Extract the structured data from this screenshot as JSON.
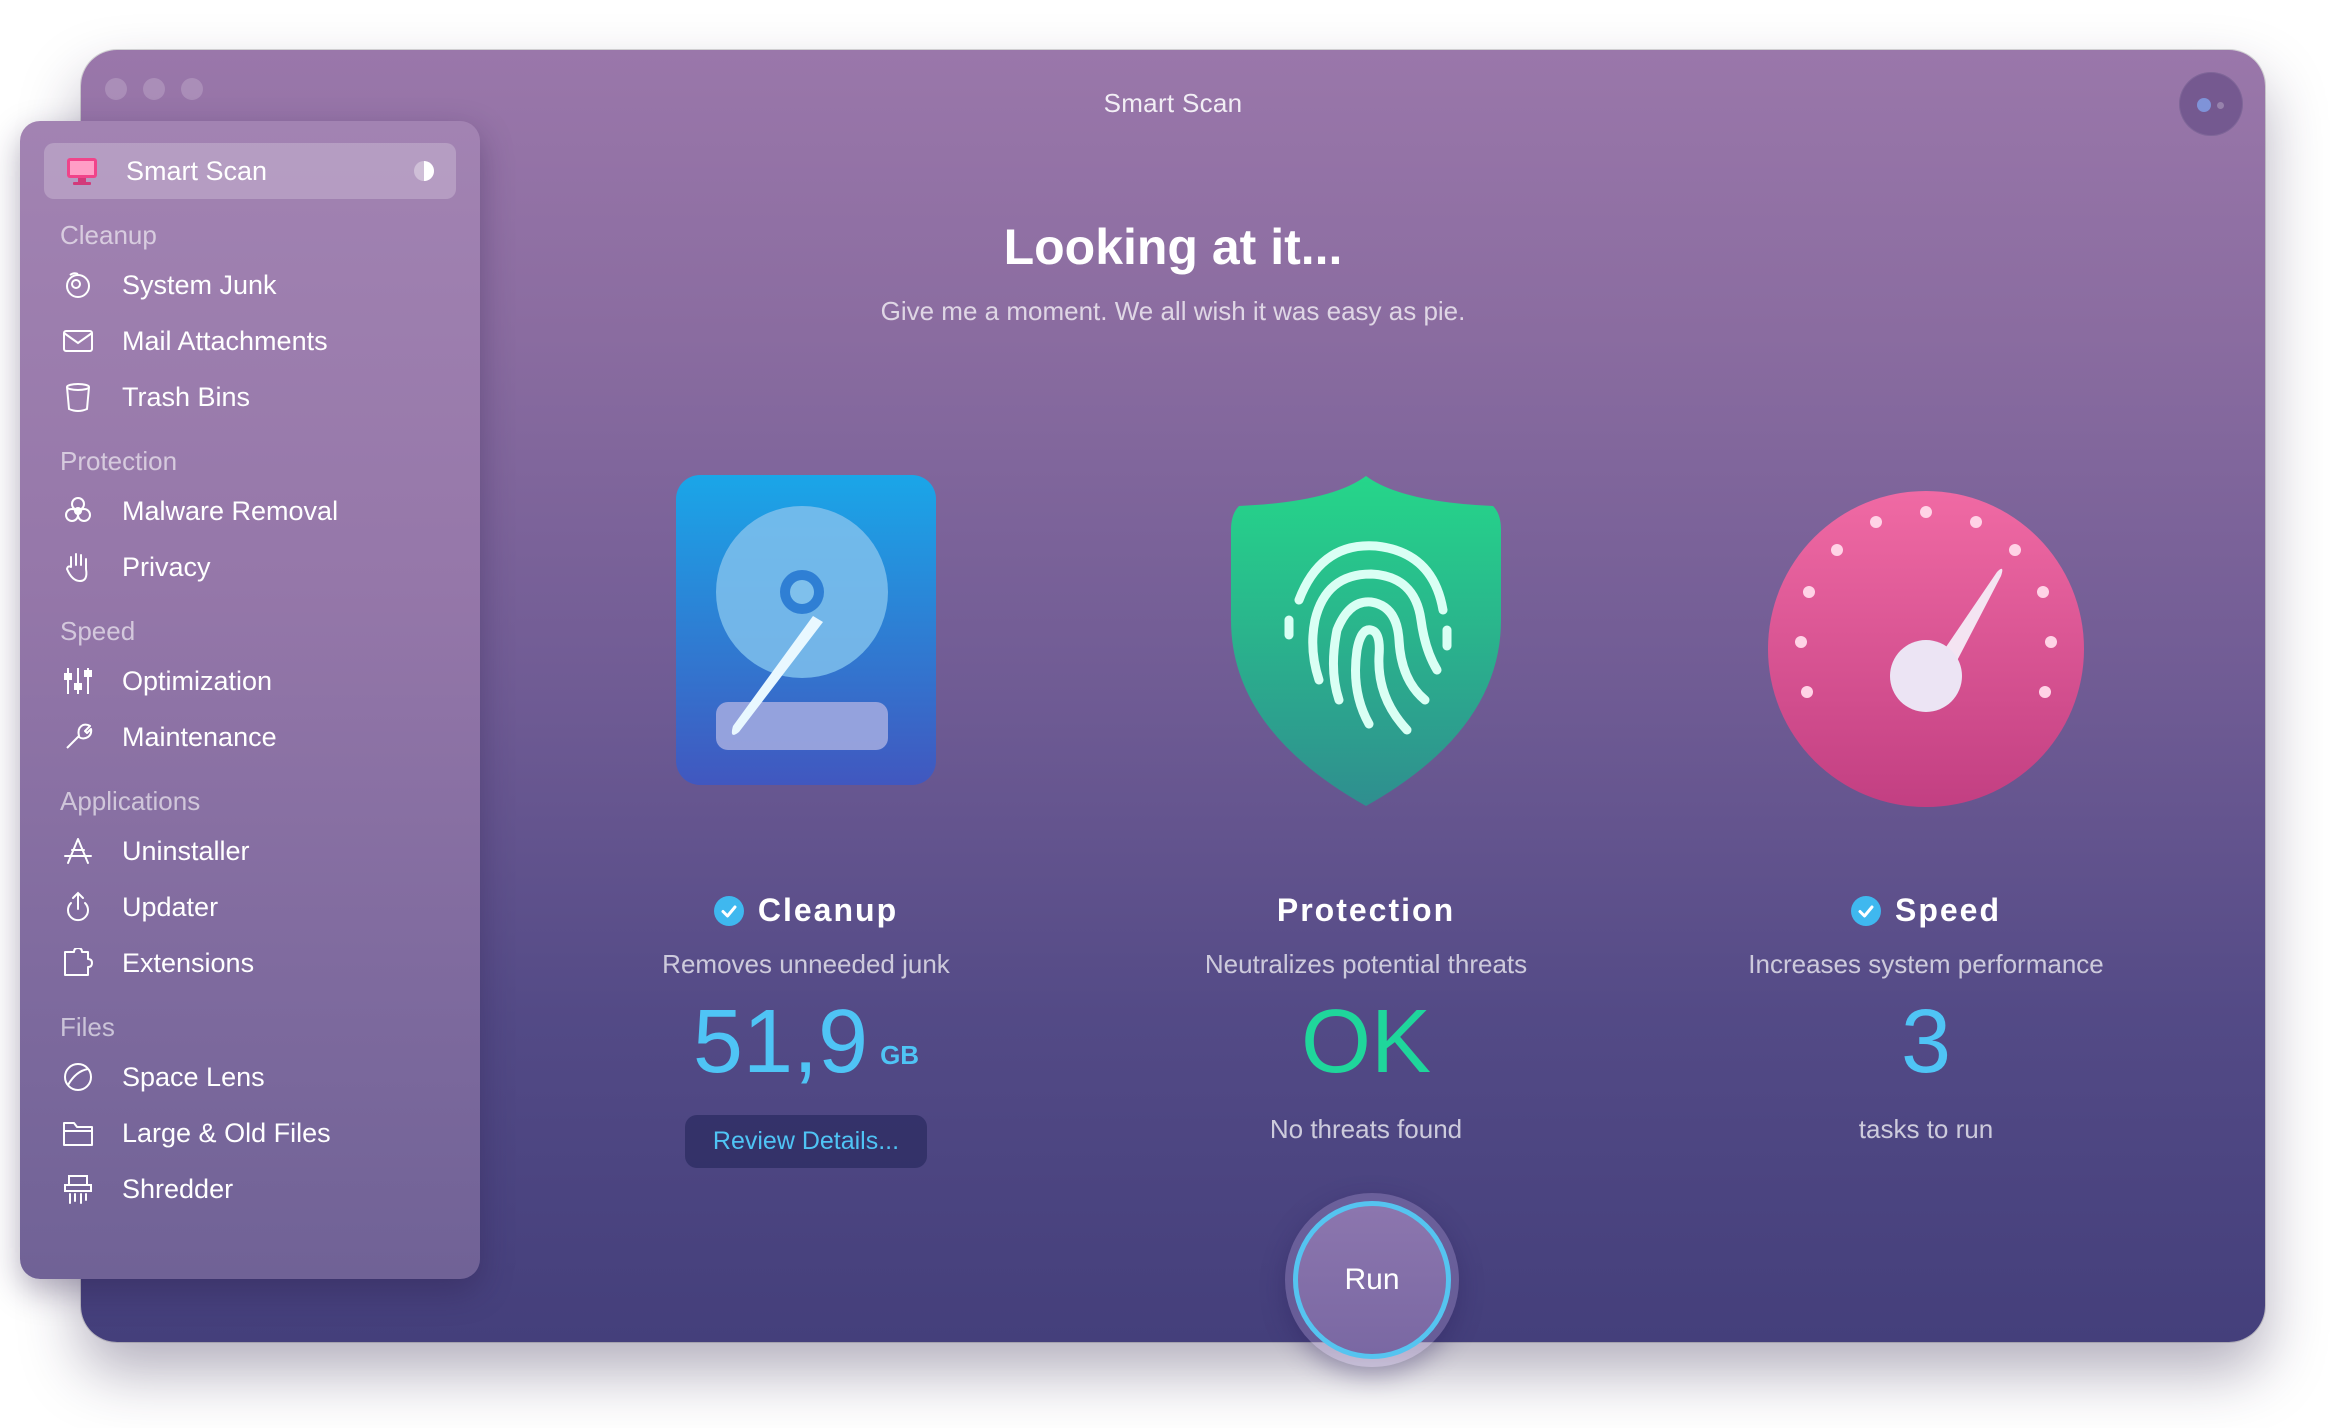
{
  "window": {
    "title": "Smart Scan"
  },
  "header": {
    "headline": "Looking at it...",
    "subline": "Give me a moment. We all wish it was easy as pie."
  },
  "sidebar": {
    "active": {
      "label": "Smart Scan",
      "icon": "monitor-icon"
    },
    "sections": [
      {
        "title": "Cleanup",
        "items": [
          {
            "label": "System Junk",
            "icon": "system-junk-icon"
          },
          {
            "label": "Mail Attachments",
            "icon": "envelope-icon"
          },
          {
            "label": "Trash Bins",
            "icon": "trash-icon"
          }
        ]
      },
      {
        "title": "Protection",
        "items": [
          {
            "label": "Malware Removal",
            "icon": "biohazard-icon"
          },
          {
            "label": "Privacy",
            "icon": "hand-icon"
          }
        ]
      },
      {
        "title": "Speed",
        "items": [
          {
            "label": "Optimization",
            "icon": "sliders-icon"
          },
          {
            "label": "Maintenance",
            "icon": "wrench-icon"
          }
        ]
      },
      {
        "title": "Applications",
        "items": [
          {
            "label": "Uninstaller",
            "icon": "uninstaller-icon"
          },
          {
            "label": "Updater",
            "icon": "update-icon"
          },
          {
            "label": "Extensions",
            "icon": "puzzle-icon"
          }
        ]
      },
      {
        "title": "Files",
        "items": [
          {
            "label": "Space Lens",
            "icon": "lens-icon"
          },
          {
            "label": "Large & Old Files",
            "icon": "folder-icon"
          },
          {
            "label": "Shredder",
            "icon": "shredder-icon"
          }
        ]
      }
    ]
  },
  "modules": {
    "cleanup": {
      "title": "Cleanup",
      "description": "Removes unneeded junk",
      "value": "51,9",
      "unit": "GB",
      "button": "Review Details..."
    },
    "protection": {
      "title": "Protection",
      "description": "Neutralizes potential threats",
      "value": "OK",
      "note": "No threats found"
    },
    "speed": {
      "title": "Speed",
      "description": "Increases system performance",
      "value": "3",
      "note": "tasks to run"
    }
  },
  "run_button": {
    "label": "Run"
  },
  "colors": {
    "accent_blue": "#4fc4f5",
    "accent_green": "#1fd69b",
    "run_ring": "#55c4f0"
  }
}
